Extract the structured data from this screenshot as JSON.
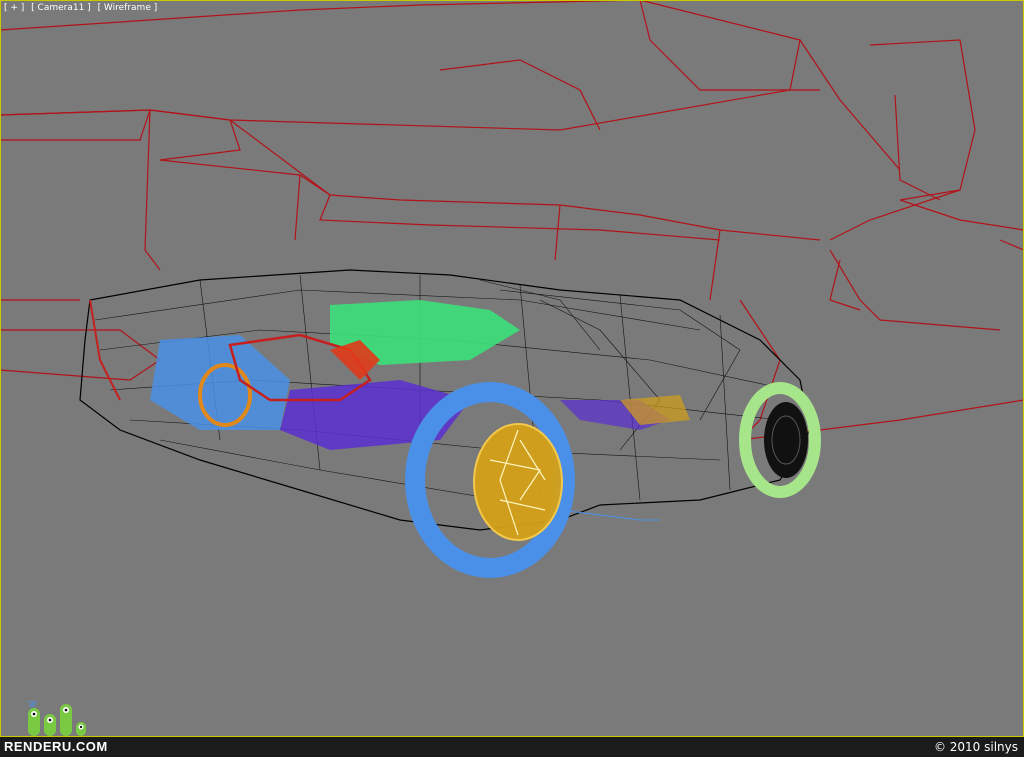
{
  "viewport": {
    "menu_label": "[ + ]",
    "camera_label": "[ Camera11 ]",
    "mode_label": "[ Wireframe ]",
    "background_color": "#7a7a7a",
    "active_border_color": "#c9c900"
  },
  "scene": {
    "wire_colors": {
      "backdrop": "#b3121a",
      "body": "#000000",
      "rear_tire": "#4a90e8",
      "rim": "#d4a017",
      "front_tire": "#a6e58a",
      "engine": "#3ce07a",
      "interior": "#5b2fd1",
      "brake": "#e03a1a"
    }
  },
  "footer": {
    "brand": "RENDERU.COM",
    "copyright": "© 2010 silnys"
  },
  "icons": {
    "mascot": "renderu-mascot-icon"
  }
}
